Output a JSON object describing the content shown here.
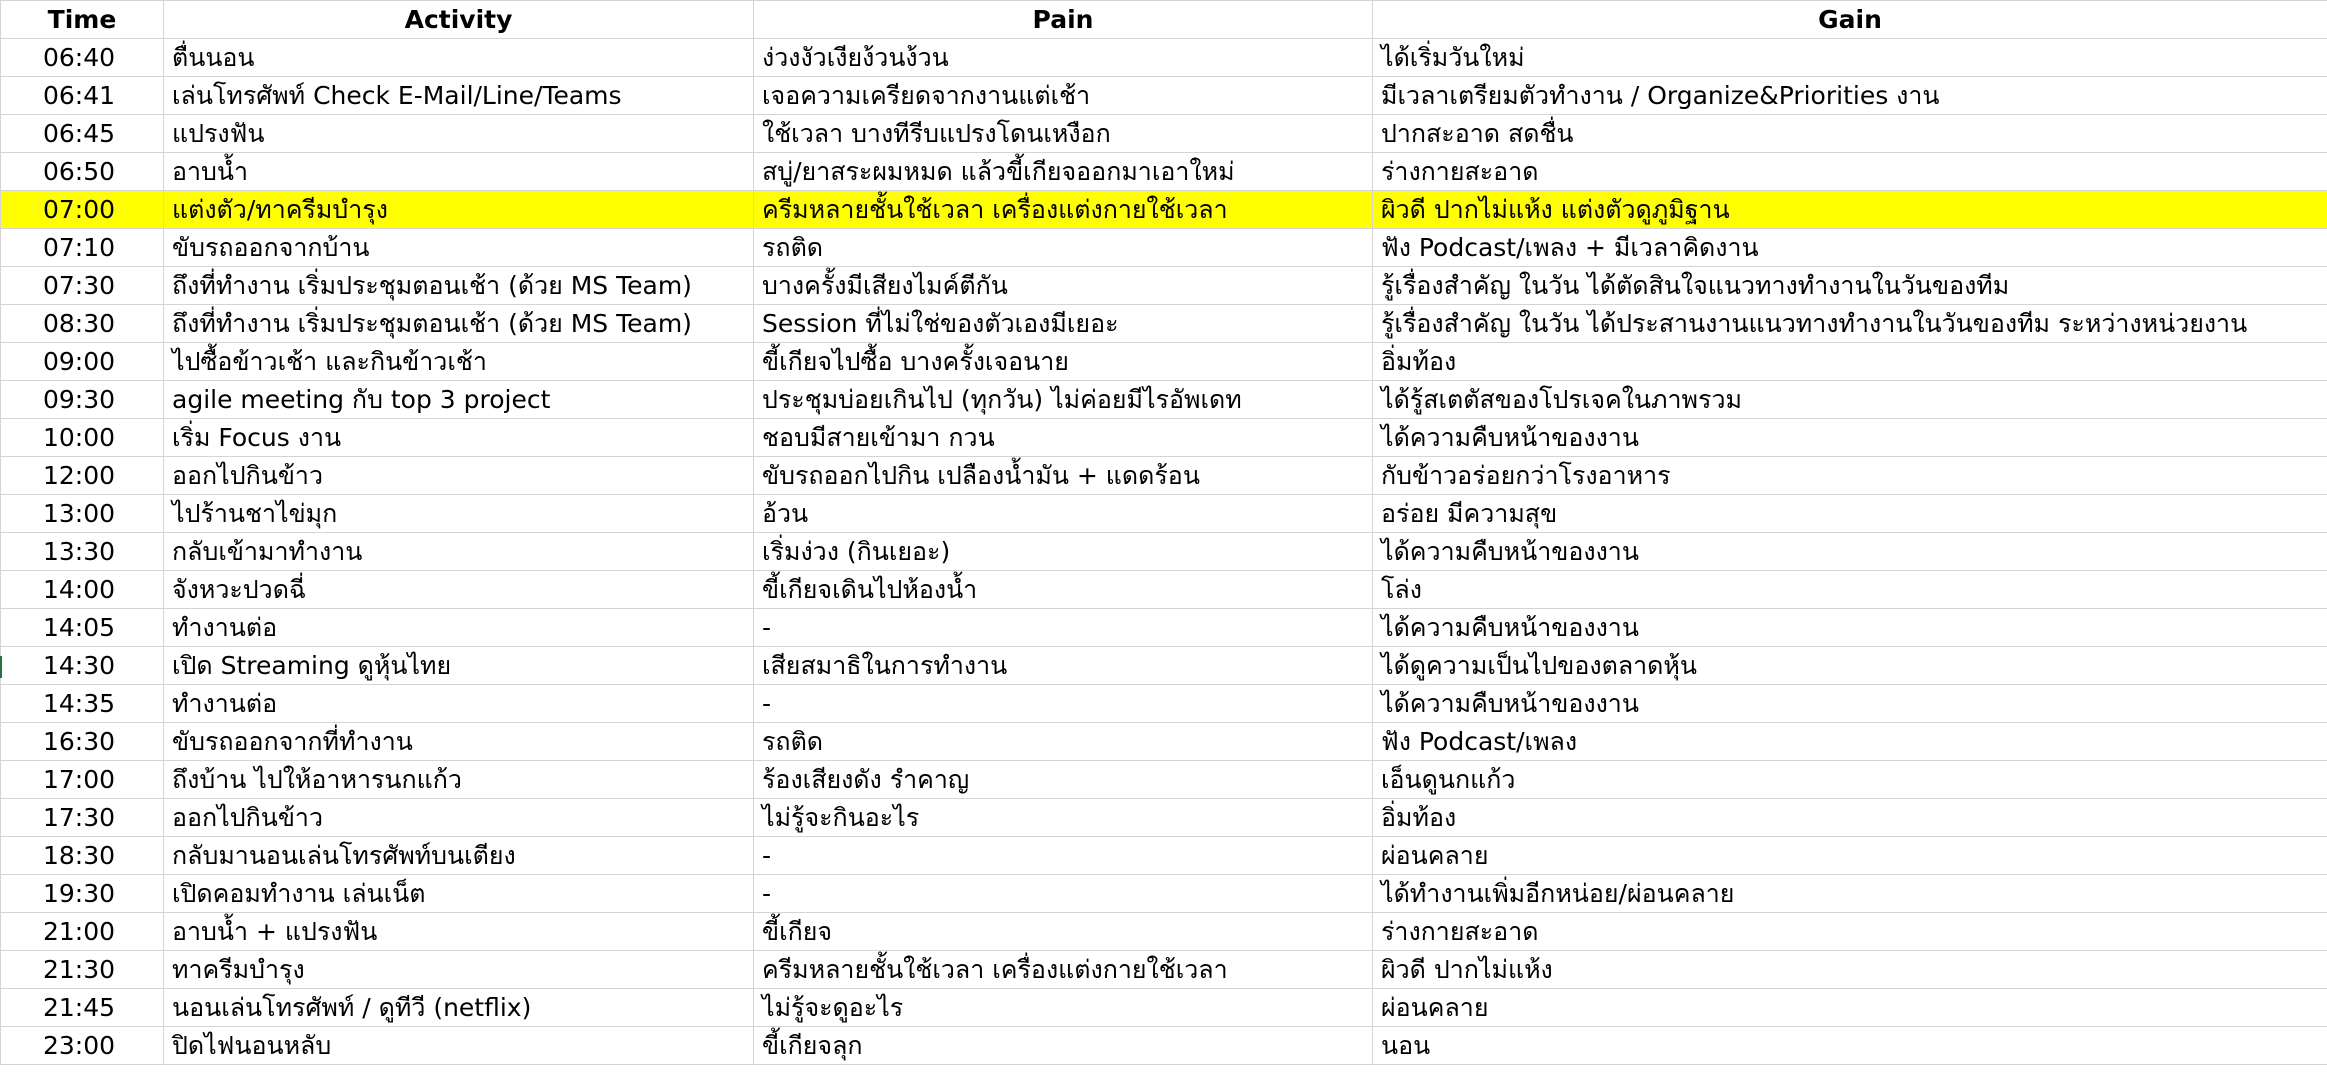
{
  "sheet": {
    "headers": {
      "time": "Time",
      "activity": "Activity",
      "pain": "Pain",
      "gain": "Gain"
    },
    "highlight_color": "#ffff00",
    "grid_color": "#d4d4d4",
    "highlighted_row_index": 4,
    "rows": [
      {
        "time": "06:40",
        "activity": "ตื่นนอน",
        "pain": "ง่วงงัวเงียง้วนง้วน",
        "gain": "ได้เริ่มวันใหม่"
      },
      {
        "time": "06:41",
        "activity": "เล่นโทรศัพท์ Check E-Mail/Line/Teams",
        "pain": "เจอความเครียดจากงานแต่เช้า",
        "gain": "มีเวลาเตรียมตัวทำงาน / Organize&Priorities งาน"
      },
      {
        "time": "06:45",
        "activity": "แปรงฟัน",
        "pain": "ใช้เวลา บางทีรีบแปรงโดนเหงือก",
        "gain": "ปากสะอาด สดชื่น"
      },
      {
        "time": "06:50",
        "activity": "อาบน้ำ",
        "pain": "สบู่/ยาสระผมหมด แล้วขี้เกียจออกมาเอาใหม่",
        "gain": "ร่างกายสะอาด"
      },
      {
        "time": "07:00",
        "activity": "แต่งตัว/ทาครีมบำรุง",
        "pain": "ครีมหลายชั้นใช้เวลา เครื่องแต่งกายใช้เวลา",
        "gain": "ผิวดี ปากไม่แห้ง แต่งตัวดูภูมิฐาน"
      },
      {
        "time": "07:10",
        "activity": "ขับรถออกจากบ้าน",
        "pain": "รถติด",
        "gain": "ฟัง Podcast/เพลง + มีเวลาคิดงาน"
      },
      {
        "time": "07:30",
        "activity": "ถึงที่ทำงาน เริ่มประชุมตอนเช้า (ด้วย MS Team)",
        "pain": "บางครั้งมีเสียงไมค์ตีกัน",
        "gain": "รู้เรื่องสำคัญ ในวัน ได้ตัดสินใจแนวทางทำงานในวันของทีม"
      },
      {
        "time": "08:30",
        "activity": "ถึงที่ทำงาน เริ่มประชุมตอนเช้า (ด้วย MS Team)",
        "pain": "Session ที่ไม่ใช่ของตัวเองมีเยอะ",
        "gain": "รู้เรื่องสำคัญ ในวัน ได้ประสานงานแนวทางทำงานในวันของทีม ระหว่างหน่วยงาน"
      },
      {
        "time": "09:00",
        "activity": "ไปซื้อข้าวเช้า และกินข้าวเช้า",
        "pain": "ขี้เกียจไปซื้อ บางครั้งเจอนาย",
        "gain": "อิ่มท้อง"
      },
      {
        "time": "09:30",
        "activity": "agile meeting กับ top 3 project",
        "pain": "ประชุมบ่อยเกินไป (ทุกวัน) ไม่ค่อยมีไรอัพเดท",
        "gain": "ได้รู้สเตตัสของโปรเจคในภาพรวม"
      },
      {
        "time": "10:00",
        "activity": "เริ่ม Focus งาน",
        "pain": "ชอบมีสายเข้ามา กวน",
        "gain": "ได้ความคืบหน้าของงาน"
      },
      {
        "time": "12:00",
        "activity": "ออกไปกินข้าว",
        "pain": "ขับรถออกไปกิน เปลืองน้ำมัน + แดดร้อน",
        "gain": "กับข้าวอร่อยกว่าโรงอาหาร"
      },
      {
        "time": "13:00",
        "activity": "ไปร้านชาไข่มุก",
        "pain": "อ้วน",
        "gain": "อร่อย มีความสุข"
      },
      {
        "time": "13:30",
        "activity": "กลับเข้ามาทำงาน",
        "pain": "เริ่มง่วง (กินเยอะ)",
        "gain": "ได้ความคืบหน้าของงาน"
      },
      {
        "time": "14:00",
        "activity": "จังหวะปวดฉี่",
        "pain": "ขี้เกียจเดินไปห้องน้ำ",
        "gain": "โล่ง"
      },
      {
        "time": "14:05",
        "activity": "ทำงานต่อ",
        "pain": "-",
        "gain": "ได้ความคืบหน้าของงาน"
      },
      {
        "time": "14:30",
        "activity": "เปิด Streaming ดูหุ้นไทย",
        "pain": "เสียสมาธิในการทำงาน",
        "gain": "ได้ดูความเป็นไปของตลาดหุ้น"
      },
      {
        "time": "14:35",
        "activity": "ทำงานต่อ",
        "pain": "-",
        "gain": "ได้ความคืบหน้าของงาน"
      },
      {
        "time": "16:30",
        "activity": "ขับรถออกจากที่ทำงาน",
        "pain": "รถติด",
        "gain": "ฟัง Podcast/เพลง"
      },
      {
        "time": "17:00",
        "activity": "ถึงบ้าน ไปให้อาหารนกแก้ว",
        "pain": "ร้องเสียงดัง รำคาญ",
        "gain": "เอ็นดูนกแก้ว"
      },
      {
        "time": "17:30",
        "activity": "ออกไปกินข้าว",
        "pain": "ไม่รู้จะกินอะไร",
        "gain": "อิ่มท้อง"
      },
      {
        "time": "18:30",
        "activity": "กลับมานอนเล่นโทรศัพท์บนเตียง",
        "pain": "-",
        "gain": "ผ่อนคลาย"
      },
      {
        "time": "19:30",
        "activity": "เปิดคอมทำงาน เล่นเน็ต",
        "pain": "-",
        "gain": "ได้ทำงานเพิ่มอีกหน่อย/ผ่อนคลาย"
      },
      {
        "time": "21:00",
        "activity": "อาบน้ำ + แปรงฟัน",
        "pain": "ขี้เกียจ",
        "gain": "ร่างกายสะอาด"
      },
      {
        "time": "21:30",
        "activity": "ทาครีมบำรุง",
        "pain": "ครีมหลายชั้นใช้เวลา เครื่องแต่งกายใช้เวลา",
        "gain": "ผิวดี ปากไม่แห้ง"
      },
      {
        "time": "21:45",
        "activity": "นอนเล่นโทรศัพท์ / ดูทีวี (netflix)",
        "pain": "ไม่รู้จะดูอะไร",
        "gain": "ผ่อนคลาย"
      },
      {
        "time": "23:00",
        "activity": "ปิดไฟนอนหลับ",
        "pain": "ขี้เกียจลุก",
        "gain": "นอน"
      }
    ]
  }
}
